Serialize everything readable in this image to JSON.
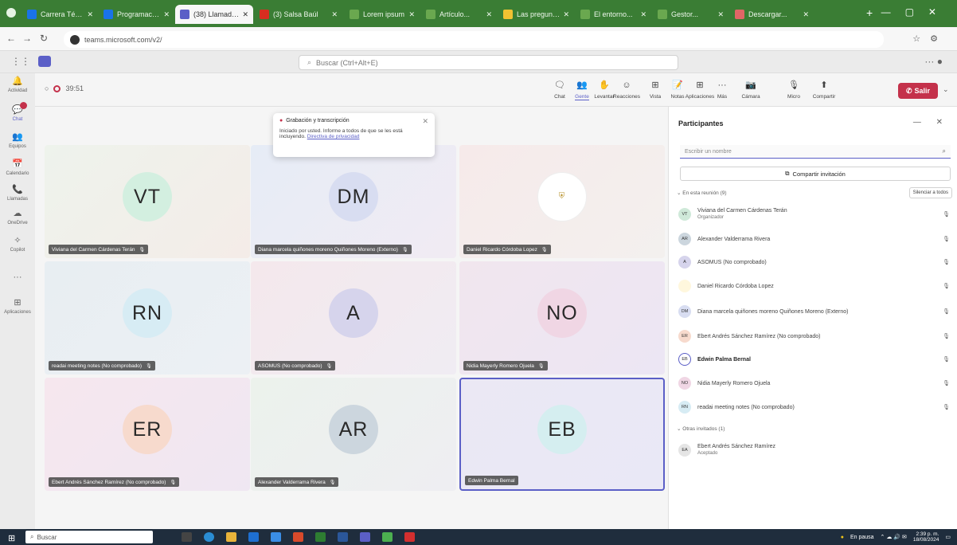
{
  "browser": {
    "tabs": [
      {
        "label": "Carrera Técnica L",
        "color": "#1a73e8",
        "active": false
      },
      {
        "label": "Programación A...",
        "color": "#1a73e8",
        "active": false
      },
      {
        "label": "(38) Llamada | Mi...",
        "color": "#5b5fc7",
        "active": true
      },
      {
        "label": "(3) Salsa Baúl",
        "color": "#d92d20",
        "active": false
      },
      {
        "label": "Lorem ipsum",
        "color": "#6aa84f",
        "active": false
      },
      {
        "label": "Artículo...",
        "color": "#6aa84f",
        "active": false
      },
      {
        "label": "Las preguntas...",
        "color": "#f1c232",
        "active": false
      },
      {
        "label": "El entorno...",
        "color": "#6aa84f",
        "active": false
      },
      {
        "label": "Gestor...",
        "color": "#6aa84f",
        "active": false
      },
      {
        "label": "Descargar...",
        "color": "#e06666",
        "active": false
      }
    ],
    "url": "teams.microsoft.com/v2/"
  },
  "teams": {
    "search_placeholder": "Buscar (Ctrl+Alt+E)"
  },
  "rail": [
    {
      "label": "Actividad",
      "icon": "bell-icon",
      "glyph": "🔔"
    },
    {
      "label": "Chat",
      "icon": "chat-icon",
      "glyph": "💬"
    },
    {
      "label": "Equipos",
      "icon": "teams-icon",
      "glyph": "👥"
    },
    {
      "label": "Calendario",
      "icon": "calendar-icon",
      "glyph": "📅"
    },
    {
      "label": "Llamadas",
      "icon": "phone-icon",
      "glyph": "📞"
    },
    {
      "label": "OneDrive",
      "icon": "cloud-icon",
      "glyph": "☁"
    },
    {
      "label": "Copilot",
      "icon": "copilot-icon",
      "glyph": "✧"
    },
    {
      "label": "",
      "icon": "more-icon",
      "glyph": "···"
    },
    {
      "label": "Aplicaciones",
      "icon": "apps-icon",
      "glyph": "⊞"
    }
  ],
  "meeting": {
    "timer": "39:51",
    "controls": [
      {
        "label": "Chat",
        "icon": "chat-icon",
        "glyph": "🗨"
      },
      {
        "label": "Gente",
        "icon": "people-icon",
        "glyph": "👥",
        "on": true
      },
      {
        "label": "Levantar",
        "icon": "raise-hand-icon",
        "glyph": "✋"
      },
      {
        "label": "Reacciones",
        "icon": "reactions-icon",
        "glyph": "☺"
      },
      {
        "label": "Vista",
        "icon": "view-icon",
        "glyph": "⊞"
      },
      {
        "label": "Notas",
        "icon": "notes-icon",
        "glyph": "📝"
      },
      {
        "label": "Aplicaciones",
        "icon": "apps-icon",
        "glyph": "⊞"
      },
      {
        "label": "Más",
        "icon": "more-icon",
        "glyph": "···"
      },
      {
        "label": "Cámara",
        "icon": "camera-icon",
        "glyph": "📷"
      },
      {
        "label": "Micro",
        "icon": "mic-icon",
        "glyph": "🎙"
      },
      {
        "label": "Compartir",
        "icon": "share-icon",
        "glyph": "⬆"
      }
    ],
    "leave_label": "Salir"
  },
  "popup": {
    "title": "Grabación y transcripción",
    "text": "Iniciado por usted. Informe a todos de que se les está incluyendo.",
    "link": "Directiva de privacidad"
  },
  "tiles": [
    {
      "initials": "VT",
      "name": "Viviana del Carmen Cárdenas Terán",
      "bg": "#d3efe0"
    },
    {
      "initials": "DM",
      "name": "Diana marcela quiñones moreno Quiñones Moreno (Externo)",
      "bg": "#d8ddf1"
    },
    {
      "initials": "",
      "name": "Daniel Ricardo Córdoba Lopez",
      "bg": "#ffffff"
    },
    {
      "initials": "RN",
      "name": "readai meeting notes (No comprobado)",
      "bg": "#d7ecf4"
    },
    {
      "initials": "A",
      "name": "ASOMUS (No comprobado)",
      "bg": "#d6d4ec"
    },
    {
      "initials": "NO",
      "name": "Nidia Mayerly Romero Ojuela",
      "bg": "#f0d6e4"
    },
    {
      "initials": "ER",
      "name": "Ebert Andrés Sánchez Ramírez (No comprobado)",
      "bg": "#f7dacd"
    },
    {
      "initials": "AR",
      "name": "Alexander Valderrama Rivera",
      "bg": "#ccd6de"
    },
    {
      "initials": "EB",
      "name": "Edwin Palma Bernal",
      "bg": "#d5eef0"
    }
  ],
  "panel": {
    "title": "Participantes",
    "search_placeholder": "Escribir un nombre",
    "share_label": "Compartir invitación",
    "section_in": "En esta reunión (9)",
    "mute_all": "Silenciar a todos",
    "participants": [
      {
        "initials": "VT",
        "name": "Viviana del Carmen Cárdenas Terán",
        "sub": "Organizador",
        "bg": "#cfe9d9",
        "bold": false
      },
      {
        "initials": "AR",
        "name": "Alexander Valderrama Rivera",
        "sub": "",
        "bg": "#ccd6de",
        "bold": false
      },
      {
        "initials": "A",
        "name": "ASOMUS (No comprobado)",
        "sub": "",
        "bg": "#d6d4ec",
        "bold": false
      },
      {
        "initials": "",
        "name": "Daniel Ricardo Córdoba Lopez",
        "sub": "",
        "bg": "#fff7dd",
        "bold": false
      },
      {
        "initials": "DM",
        "name": "Diana marcela quiñones moreno Quiñones Moreno (Externo)",
        "sub": "",
        "bg": "#d8ddf1",
        "bold": false
      },
      {
        "initials": "ER",
        "name": "Ebert Andrés Sánchez Ramírez (No comprobado)",
        "sub": "",
        "bg": "#f7dacd",
        "bold": false
      },
      {
        "initials": "EB",
        "name": "Edwin Palma Bernal",
        "sub": "",
        "bg": "#ffffff",
        "bold": true
      },
      {
        "initials": "NO",
        "name": "Nidia Mayerly Romero Ojuela",
        "sub": "",
        "bg": "#f0d6e4",
        "bold": false
      },
      {
        "initials": "RN",
        "name": "readai meeting notes (No comprobado)",
        "sub": "",
        "bg": "#d7ecf4",
        "bold": false
      }
    ],
    "section_others": "Otras invitados (1)",
    "others": [
      {
        "initials": "EA",
        "name": "Ebert Andrés Sánchez Ramírez",
        "sub": "Aceptado",
        "bg": "#e5e5e5",
        "bold": false
      }
    ]
  },
  "taskbar": {
    "search_placeholder": "Buscar",
    "tray_status": "En pausa",
    "time": "2:39 p. m.",
    "date": "18/08/2024"
  }
}
